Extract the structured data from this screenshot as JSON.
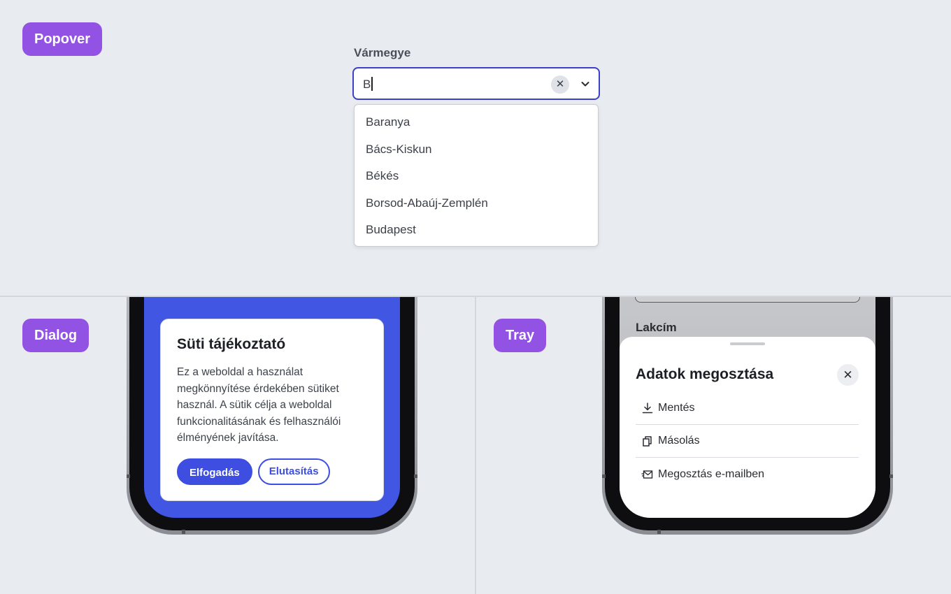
{
  "tags": {
    "popover": "Popover",
    "dialog": "Dialog",
    "tray": "Tray"
  },
  "combobox": {
    "label": "Vármegye",
    "value": "B",
    "options": [
      "Baranya",
      "Bács-Kiskun",
      "Békés",
      "Borsod-Abaúj-Zemplén",
      "Budapest"
    ]
  },
  "dialog": {
    "title": "Süti tájékoztató",
    "body": "Ez a weboldal a használat megkönnyítése érdekében sütiket használ. A sütik célja a weboldal funkcionalitásának és felhasználói élményének javítása.",
    "accept": "Elfogadás",
    "reject": "Elutasítás",
    "screen_color": "#4256e4"
  },
  "tray": {
    "background_label": "Lakcím",
    "title": "Adatok megosztása",
    "items": [
      {
        "label": "Mentés",
        "icon": "download-icon"
      },
      {
        "label": "Másolás",
        "icon": "copy-icon"
      },
      {
        "label": "Megosztás e-mailben",
        "icon": "mail-icon"
      }
    ]
  },
  "colors": {
    "tag": "#9253e4",
    "focus": "#3b40c9",
    "primary": "#3d4ee0",
    "background": "#e8ebf0"
  }
}
